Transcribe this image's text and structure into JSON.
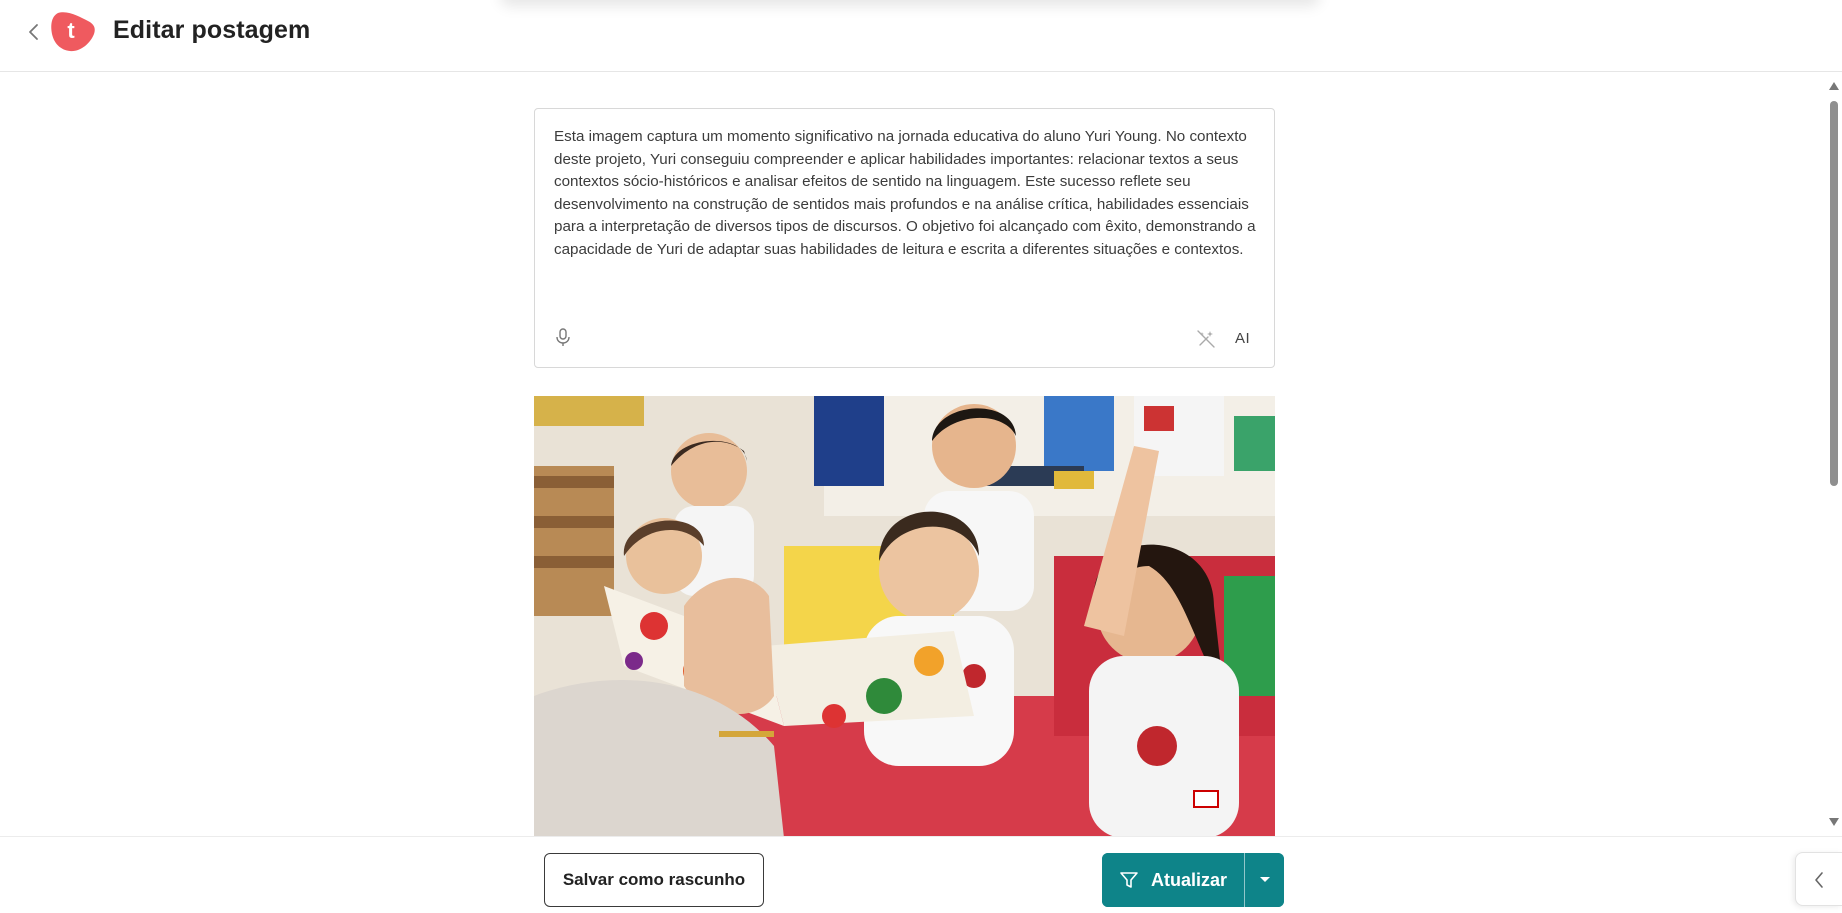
{
  "header": {
    "title": "Editar postagem",
    "logo_letter": "t",
    "logo_color": "#ef5a5f"
  },
  "editor": {
    "text": "Esta imagem captura um momento significativo na jornada educativa do aluno Yuri Young. No contexto deste projeto, Yuri conseguiu compreender e aplicar habilidades importantes: relacionar textos a seus contextos sócio-históricos e analisar efeitos de sentido na linguagem. Este sucesso reflete seu desenvolvimento na construção de sentidos mais profundos e na análise crítica, habilidades essenciais para a interpretação de diversos tipos de discursos. O objetivo foi alcançado com êxito, demonstrando a capacidade de Yuri de adaptar suas habilidades de leitura e escrita a diferentes situações e contextos.",
    "ai_label": "AI",
    "icons": {
      "mic": "microphone-icon",
      "magic": "magic-wand-off-icon"
    }
  },
  "footer": {
    "draft_label": "Salvar como rascunho",
    "update_label": "Atualizar",
    "accent_color": "#0e8489"
  }
}
